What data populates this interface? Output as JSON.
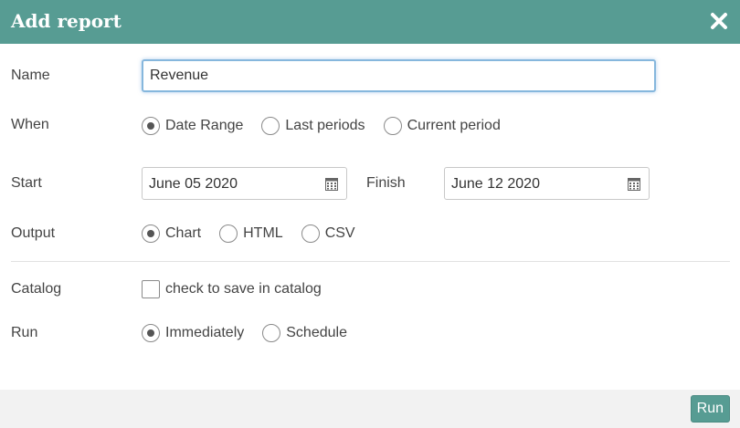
{
  "header": {
    "title": "Add report",
    "close_icon": "close-icon"
  },
  "form": {
    "name_label": "Name",
    "name_value": "Revenue",
    "when_label": "When",
    "when_options": [
      {
        "label": "Date Range",
        "checked": true
      },
      {
        "label": "Last periods",
        "checked": false
      },
      {
        "label": "Current period",
        "checked": false
      }
    ],
    "start_label": "Start",
    "start_value": "June 05 2020",
    "finish_label": "Finish",
    "finish_value": "June 12 2020",
    "output_label": "Output",
    "output_options": [
      {
        "label": "Chart",
        "checked": true
      },
      {
        "label": "HTML",
        "checked": false
      },
      {
        "label": "CSV",
        "checked": false
      }
    ],
    "catalog_label": "Catalog",
    "catalog_checkbox_label": "check to save in catalog",
    "catalog_checked": false,
    "run_label": "Run",
    "run_options": [
      {
        "label": "Immediately",
        "checked": true
      },
      {
        "label": "Schedule",
        "checked": false
      }
    ]
  },
  "footer": {
    "run_button_label": "Run"
  },
  "colors": {
    "accent": "#579c93",
    "footer_bg": "#f2f2f2",
    "focus_border": "#86b7dd"
  }
}
